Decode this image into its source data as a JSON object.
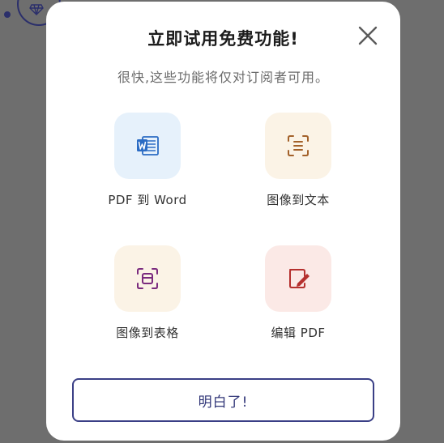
{
  "background": {
    "icon": "diamond-icon",
    "color": "#2b2f6b"
  },
  "modal": {
    "title": "立即试用免费功能!",
    "subtitle": "很快,这些功能将仅对订阅者可用。",
    "close_icon": "close-icon",
    "features": [
      {
        "label": "PDF 到 Word",
        "icon": "word-icon",
        "tile_color": "#e6f1fb",
        "icon_color": "#2b6cc4"
      },
      {
        "label": "图像到文本",
        "icon": "text-scan-icon",
        "tile_color": "#fbf3e6",
        "icon_color": "#a3612a"
      },
      {
        "label": "图像到表格",
        "icon": "table-scan-icon",
        "tile_color": "#fbf3e6",
        "icon_color": "#7a2a7e"
      },
      {
        "label": "编辑 PDF",
        "icon": "edit-pdf-icon",
        "tile_color": "#fbe9e6",
        "icon_color": "#b5302e"
      }
    ],
    "confirm_label": "明白了!",
    "accent_color": "#3a3f86"
  }
}
